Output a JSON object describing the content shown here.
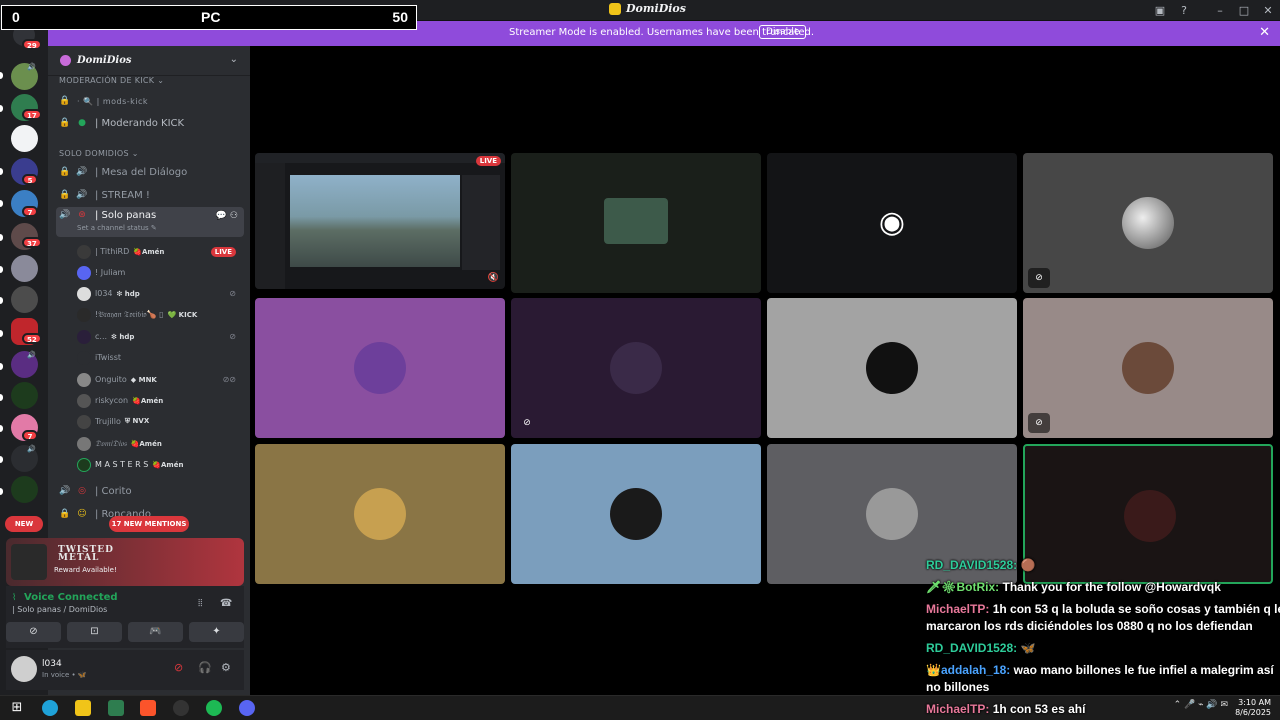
{
  "titlebar": {
    "title": "DomiDios",
    "icons": [
      "screen-share-icon",
      "help-icon",
      "minimize-icon",
      "maximize-icon",
      "close-icon"
    ],
    "glyphs": [
      "▣",
      "?",
      "–",
      "□",
      "✕"
    ]
  },
  "score_overlay": {
    "left": "0",
    "center": "PC",
    "right": "50"
  },
  "banner": {
    "text": "Streamer Mode is enabled. Usernames have been truncated.",
    "button": "Disable",
    "close": "✕",
    "color": "#8f4bdb"
  },
  "server_rail": {
    "home_badge": "29",
    "badges": [
      "17",
      "5",
      "7",
      "37",
      "52",
      "7"
    ]
  },
  "guild": {
    "name": "DomiDios",
    "chevron": "⌄"
  },
  "categories": {
    "mod": "MODERACIÓN DE KICK ⌄",
    "solo": "SOLO DOMIDIOS ⌄"
  },
  "channels": {
    "mods_kick": "· 🔍 | mods-kick",
    "moderando": "| Moderando KICK",
    "mesa": "| Mesa del Diálogo",
    "stream": "| STREAM !",
    "solo_panas": "| Solo panas",
    "solo_panas_status": "Set a channel status ✎",
    "corito": "| Corito",
    "roncando": "| Roncando"
  },
  "voice_users": [
    {
      "name": "| TithiRD",
      "tag": "🍓Amén",
      "live": "LIVE"
    },
    {
      "name": "! Juliam",
      "tag": ""
    },
    {
      "name": "l034",
      "tag": "❇ hdp"
    },
    {
      "name": "!𝔅𝔯𝔞𝔶𝔞𝔫 𝔗𝔬𝔯𝔦𝔟𝔦𝔬🍗 ▯",
      "tag": "💚 KICK"
    },
    {
      "name": "c...",
      "tag": "❇ hdp"
    },
    {
      "name": "iTwisst",
      "tag": ""
    },
    {
      "name": "Onguito",
      "tag": "◆ MNK"
    },
    {
      "name": "riskycon",
      "tag": "🍓Amén"
    },
    {
      "name": "Trujillo",
      "tag": "⛨ NVX"
    },
    {
      "name": "𝔇𝔬𝔪𝔦𝔇𝔦𝔬𝔰",
      "tag": "🍓Amén"
    },
    {
      "name": "M A S T E R S",
      "tag": "🍓Amén"
    }
  ],
  "pills": {
    "new": "NEW",
    "mentions": "17 NEW MENTIONS"
  },
  "promo": {
    "title_line1": "TWISTED",
    "title_line2": "METAL",
    "reward": "Reward Available!"
  },
  "voice_panel": {
    "status": "Voice Connected",
    "channel": "| Solo panas / DomiDios"
  },
  "voice_buttons": [
    "⊘",
    "⊡",
    "🎮",
    "✦"
  ],
  "user_panel": {
    "name": "l034",
    "status": "In voice • 🦋"
  },
  "chat_overlay": [
    {
      "user": "RD_DAVID1528:",
      "msg": "🟤",
      "color": "#2ecc9a"
    },
    {
      "user": "🗡❇BotRix:",
      "msg": "Thank you for the follow @Howardvqk",
      "color": "#6fe06f"
    },
    {
      "user": "MichaelTP:",
      "msg": "1h con 53 q la boluda se soño cosas y también q le",
      "color": "#e8789a"
    },
    {
      "user": "",
      "msg": "marcaron los rds diciéndoles los 0880 q no los defiendan",
      "color": "#e8789a"
    },
    {
      "user": "RD_DAVID1528:",
      "msg": "🦋",
      "color": "#2ecc9a"
    },
    {
      "user": "👑addalah_18:",
      "msg": "wao mano billones le fue infiel a malegrim así",
      "color": "#4aa3ff"
    },
    {
      "user": "",
      "msg": "no billones",
      "color": "#4aa3ff"
    },
    {
      "user": "MichaelTP:",
      "msg": "1h con 53 es ahí",
      "color": "#e8789a"
    }
  ],
  "stream_tile": {
    "live": "LIVE"
  },
  "taskbar": {
    "time": "3:10 AM",
    "date": "8/6/2025",
    "tray": "⌃  🎤 ⌁ 🔊 ✉"
  }
}
